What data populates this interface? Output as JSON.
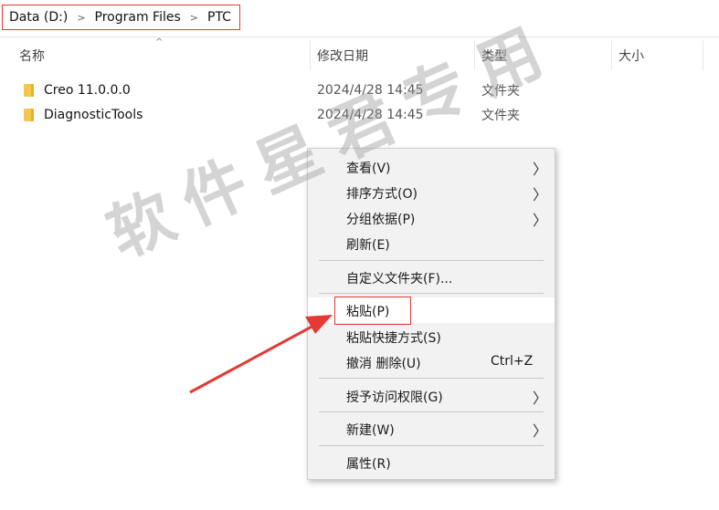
{
  "breadcrumb": {
    "items": [
      "Data (D:)",
      "Program Files",
      "PTC"
    ],
    "separator": ">"
  },
  "columns": {
    "name": "名称",
    "date": "修改日期",
    "type": "类型",
    "size": "大小",
    "sort_indicator": "^"
  },
  "files": [
    {
      "name": "Creo 11.0.0.0",
      "date": "2024/4/28 14:45",
      "type": "文件夹",
      "icon": "folder-icon"
    },
    {
      "name": "DiagnosticTools",
      "date": "2024/4/28 14:45",
      "type": "文件夹",
      "icon": "folder-icon"
    }
  ],
  "context_menu": {
    "view": "查看(V)",
    "sort_by": "排序方式(O)",
    "group_by": "分组依据(P)",
    "refresh": "刷新(E)",
    "customize": "自定义文件夹(F)...",
    "paste": "粘贴(P)",
    "paste_shortcut": "粘贴快捷方式(S)",
    "undo_delete": "撤消 删除(U)",
    "undo_shortcut": "Ctrl+Z",
    "grant_access": "授予访问权限(G)",
    "new": "新建(W)",
    "properties": "属性(R)",
    "submenu_arrow": "〉"
  },
  "watermark": "软件星君专用",
  "colors": {
    "annotation_red": "#e53935",
    "folder_yellow": "#f3c84b",
    "menu_bg": "#f2f2f2"
  }
}
